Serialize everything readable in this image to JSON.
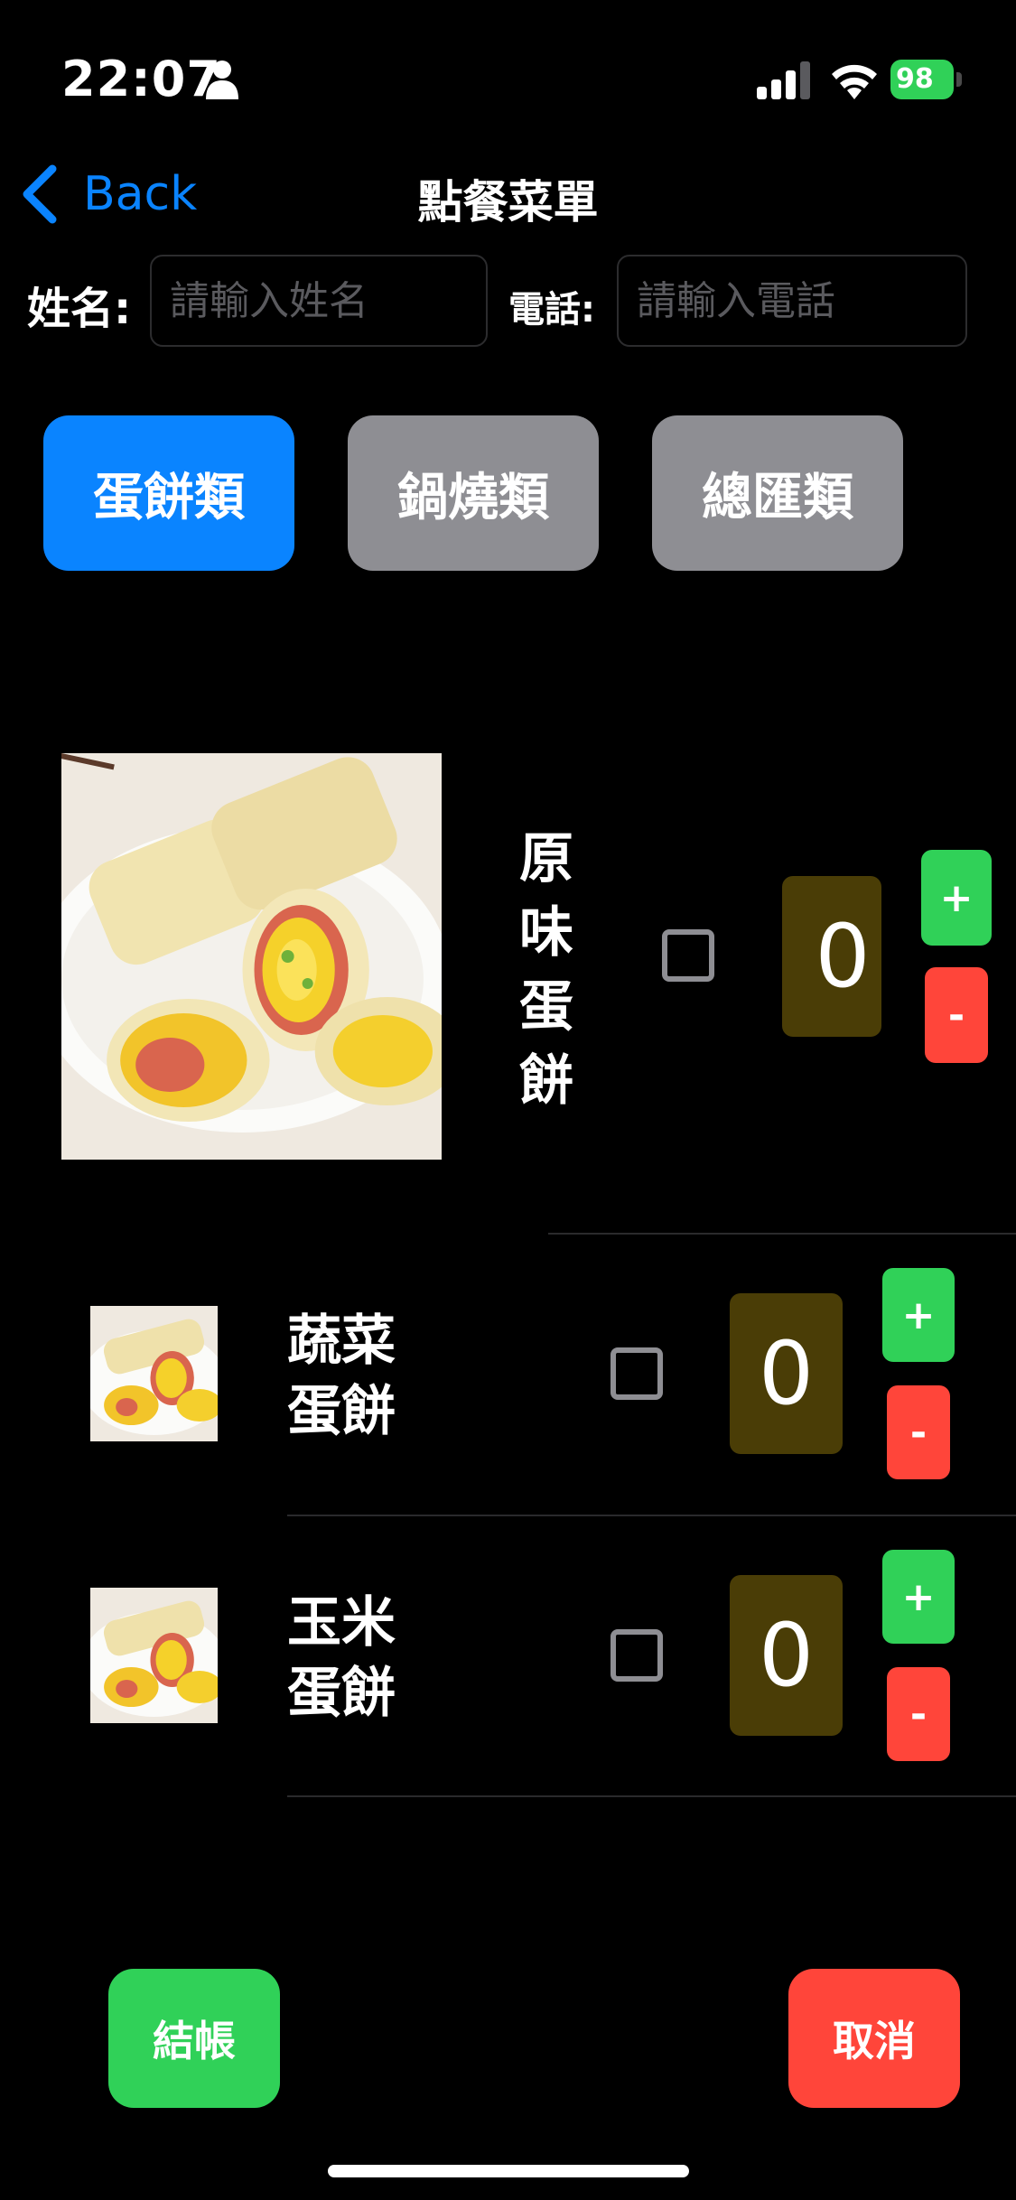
{
  "status_bar": {
    "time": "22:07",
    "battery": "98"
  },
  "nav": {
    "back_label": "Back",
    "title": "點餐菜單"
  },
  "form": {
    "name_label": "姓名:",
    "name_placeholder": "請輸入姓名",
    "name_value": "",
    "phone_label": "電話:",
    "phone_placeholder": "請輸入電話",
    "phone_value": ""
  },
  "tabs": [
    {
      "label": "蛋餅類",
      "active": true
    },
    {
      "label": "鍋燒類",
      "active": false
    },
    {
      "label": "總匯類",
      "active": false
    }
  ],
  "items": [
    {
      "name": "原味蛋餅",
      "name_lines": [
        "原",
        "味",
        "蛋",
        "餅"
      ],
      "checked": false,
      "qty": "0"
    },
    {
      "name": "蔬菜蛋餅",
      "name_lines": [
        "蔬菜",
        "蛋餅"
      ],
      "checked": false,
      "qty": "0"
    },
    {
      "name": "玉米蛋餅",
      "name_lines": [
        "玉米",
        "蛋餅"
      ],
      "checked": false,
      "qty": "0"
    }
  ],
  "stepper": {
    "plus": "+",
    "minus": "-"
  },
  "actions": {
    "checkout": "結帳",
    "cancel": "取消"
  },
  "colors": {
    "accent": "#0a84ff",
    "green": "#30d158",
    "red": "#ff453a",
    "inactive": "#8e8e93",
    "qty_bg": "#4a3d06"
  },
  "icons": [
    "person-icon",
    "signal-icon",
    "wifi-icon",
    "battery-icon",
    "chevron-left-icon"
  ]
}
